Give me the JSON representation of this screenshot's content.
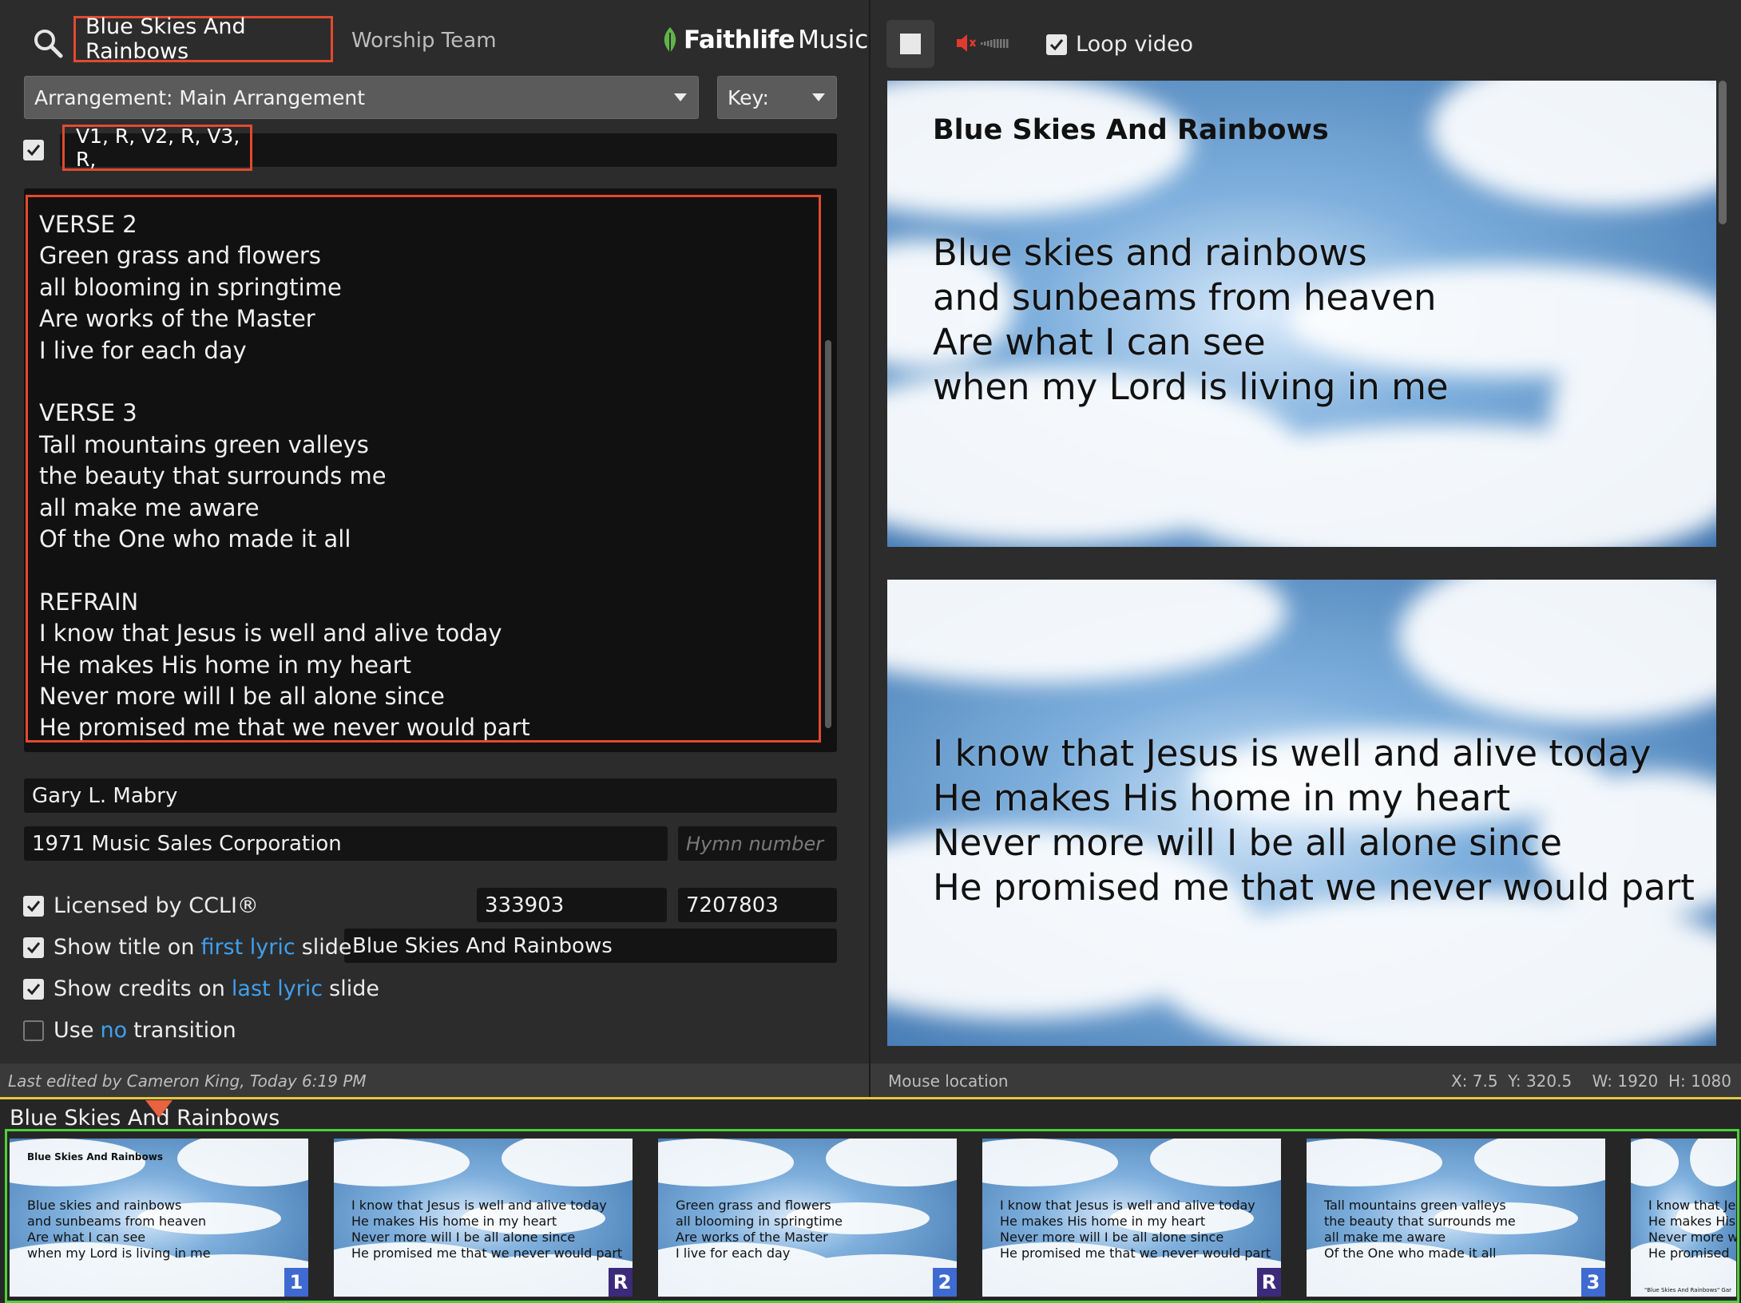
{
  "header": {
    "search_icon": "search-icon",
    "song_title": "Blue Skies And Rainbows",
    "team": "Worship Team",
    "brand_bold": "Faithlife",
    "brand_light": "Music"
  },
  "arrangement": {
    "label": "Arrangement: Main Arrangement"
  },
  "key": {
    "label": "Key:"
  },
  "order": {
    "value": "V1, R, V2, R, V3, R,"
  },
  "lyrics": {
    "stanzas": [
      [
        "VERSE 2",
        "Green grass and flowers",
        "all blooming in springtime",
        "Are works of the Master",
        "I live for each day"
      ],
      [
        "VERSE 3",
        "Tall mountains green valleys",
        "the beauty that surrounds me",
        "all make me aware",
        "Of the One who made it all"
      ],
      [
        "REFRAIN",
        "I know that Jesus is well and alive today",
        "He makes His home in my heart",
        "Never more will I be all alone since",
        "He promised me that we never would part"
      ]
    ]
  },
  "meta": {
    "author": "Gary L. Mabry",
    "copyright": "1971 Music Sales Corporation",
    "hymn_placeholder": "Hymn number",
    "ccli_song": "333903",
    "ccli_license": "7207803"
  },
  "options": {
    "ccli_label": "Licensed by CCLI®",
    "title_pre": "Show title on",
    "title_link": "first lyric",
    "title_post": "slide",
    "title_value": "Blue Skies And Rainbows",
    "credits_pre": "Show credits on",
    "credits_link": "last lyric",
    "credits_post": "slide",
    "trans_pre": "Use",
    "trans_link": "no",
    "trans_post": "transition"
  },
  "status": {
    "last_edited": "Last edited by Cameron King, Today 6:19 PM",
    "mouse_label": "Mouse location",
    "coords": "X: 7.5  Y: 320.5    W: 1920  H: 1080"
  },
  "player": {
    "stop_icon": "stop-icon",
    "mute_icon": "muted-speaker-icon",
    "loop_label": "Loop video"
  },
  "preview1": {
    "title": "Blue Skies And Rainbows",
    "lines": [
      "Blue skies and rainbows",
      "and sunbeams from heaven",
      "Are what I can see",
      "when my Lord is living in me"
    ]
  },
  "preview2": {
    "lines": [
      "I know that Jesus is well and alive today",
      "He makes His home in my heart",
      "Never more will I be all alone since",
      "He promised me that we never would part"
    ]
  },
  "strip": {
    "title": "Blue Skies And Rainbows",
    "thumbs": [
      {
        "title": "Blue Skies And Rainbows",
        "lines": [
          "Blue skies and rainbows",
          "and sunbeams from heaven",
          "Are what I can see",
          "when my Lord is living in me"
        ],
        "badge": "1",
        "kind": "v"
      },
      {
        "title": "",
        "lines": [
          "I know that Jesus is well and alive today",
          "He makes His home in my heart",
          "Never more will I be all alone since",
          "He promised me that we never would part"
        ],
        "badge": "R",
        "kind": "r"
      },
      {
        "title": "",
        "lines": [
          "Green grass and flowers",
          "all blooming in springtime",
          "Are works of the Master",
          "I live for each day"
        ],
        "badge": "2",
        "kind": "v"
      },
      {
        "title": "",
        "lines": [
          "I know that Jesus is well and alive today",
          "He makes His home in my heart",
          "Never more will I be all alone since",
          "He promised me that we never would part"
        ],
        "badge": "R",
        "kind": "r"
      },
      {
        "title": "",
        "lines": [
          "Tall mountains green valleys",
          "the beauty that surrounds me",
          "all make me aware",
          "Of the One who made it all"
        ],
        "badge": "3",
        "kind": "v"
      },
      {
        "title": "",
        "lines": [
          "I know that Je",
          "He makes His",
          "Never more w",
          "He promised"
        ],
        "badge": "",
        "kind": "r",
        "credit": "\"Blue Skies And Rainbows\" Gar"
      }
    ]
  }
}
